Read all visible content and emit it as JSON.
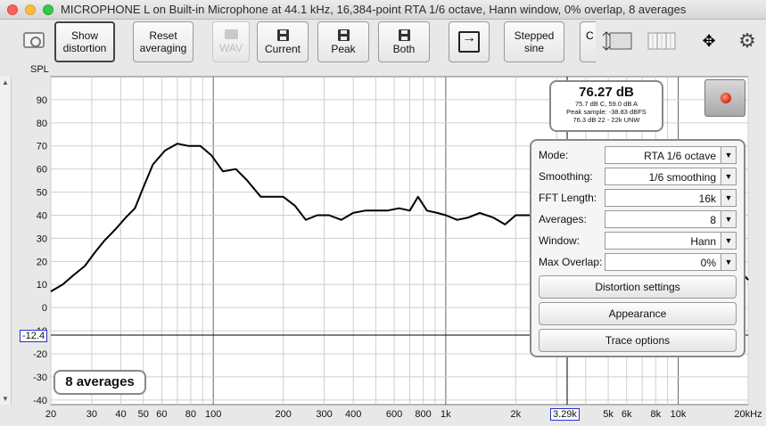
{
  "window": {
    "title": "MICROPHONE L on Built-in Microphone at 44.1 kHz, 16,384-point RTA 1/6 octave, Hann window, 0% overlap, 8 averages"
  },
  "toolbar": {
    "show_distortion": [
      "Show",
      "distortion"
    ],
    "reset_averaging": [
      "Reset",
      "averaging"
    ],
    "wav": "WAV",
    "current": "Current",
    "peak": "Peak",
    "both": "Both",
    "stepped_sine": [
      "Stepped",
      "sine"
    ],
    "cut_label": "C"
  },
  "graph": {
    "y_axis_label": "SPL",
    "cursor_y": "-12.4",
    "cursor_x": "3.29k",
    "averages_label": "8 averages"
  },
  "spl_meter": {
    "main": "76.27 dB",
    "line1": "75.7 dB C, 59.0 dB A",
    "line2": "Peak sample: -38.83 dBFS",
    "line3": "76.3 dB 22 - 22k UNW"
  },
  "settings": {
    "mode_label": "Mode:",
    "mode_value": "RTA 1/6 octave",
    "smoothing_label": "Smoothing:",
    "smoothing_value": "1/6 smoothing",
    "fft_label": "FFT Length:",
    "fft_value": "16k",
    "averages_label": "Averages:",
    "averages_value": "8",
    "window_label": "Window:",
    "window_value": "Hann",
    "overlap_label": "Max Overlap:",
    "overlap_value": "0%",
    "distortion_button": "Distortion settings",
    "appearance_button": "Appearance",
    "trace_button": "Trace options"
  },
  "chart_data": {
    "type": "line",
    "x_scale": "log",
    "xlim": [
      20,
      20000
    ],
    "ylim": [
      -42,
      100
    ],
    "yticks": [
      90,
      80,
      70,
      60,
      50,
      40,
      30,
      20,
      10,
      0,
      -10,
      -20,
      -30,
      -40
    ],
    "xticks": [
      {
        "v": 20,
        "label": "20"
      },
      {
        "v": 30,
        "label": "30"
      },
      {
        "v": 40,
        "label": "40"
      },
      {
        "v": 50,
        "label": "50"
      },
      {
        "v": 60,
        "label": "60"
      },
      {
        "v": 80,
        "label": "80"
      },
      {
        "v": 100,
        "label": "100"
      },
      {
        "v": 200,
        "label": "200"
      },
      {
        "v": 300,
        "label": "300"
      },
      {
        "v": 400,
        "label": "400"
      },
      {
        "v": 600,
        "label": "600"
      },
      {
        "v": 800,
        "label": "800"
      },
      {
        "v": 1000,
        "label": "1k"
      },
      {
        "v": 2000,
        "label": "2k"
      },
      {
        "v": 5000,
        "label": "5k"
      },
      {
        "v": 6000,
        "label": "6k"
      },
      {
        "v": 8000,
        "label": "8k"
      },
      {
        "v": 10000,
        "label": "10k"
      },
      {
        "v": 20000,
        "label": "20kHz"
      }
    ],
    "grid": true,
    "series": [
      {
        "color": "#000000",
        "x": [
          20,
          22.5,
          25,
          28,
          31,
          34,
          38,
          42,
          46,
          50,
          55,
          62,
          70,
          78,
          88,
          98,
          110,
          125,
          140,
          160,
          180,
          200,
          225,
          250,
          280,
          315,
          355,
          400,
          450,
          500,
          560,
          630,
          700,
          760,
          830,
          920,
          1000,
          1120,
          1250,
          1400,
          1600,
          1800,
          2000,
          2300,
          2600,
          3000,
          3500,
          4000,
          5000,
          6000,
          8000,
          10000,
          14000,
          20000
        ],
        "y": [
          7,
          10,
          14,
          18,
          24,
          29,
          34,
          39,
          43,
          52,
          62,
          68,
          71,
          70,
          70,
          66,
          59,
          60,
          55,
          48,
          48,
          48,
          44,
          38,
          40,
          40,
          38,
          41,
          42,
          42,
          42,
          43,
          42,
          48,
          42,
          41,
          40,
          38,
          39,
          41,
          39,
          36,
          40,
          40,
          42,
          45,
          45,
          44,
          43,
          44,
          42,
          40,
          30,
          12
        ]
      }
    ]
  },
  "icons": {
    "camera": "camera-icon",
    "gear": "gear-icon",
    "record": "record-icon"
  }
}
